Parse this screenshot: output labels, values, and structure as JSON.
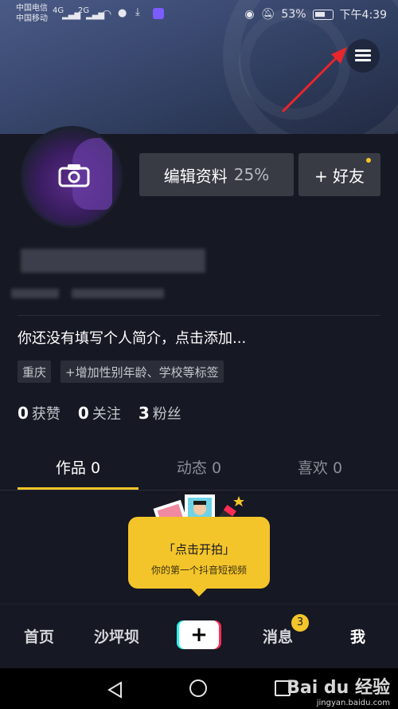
{
  "status_bar": {
    "carrier1": "中国电信",
    "carrier2": "中国移动",
    "signal1": "4G",
    "signal2": "2G",
    "battery": "53%",
    "time": "下午4:39",
    "icons": [
      "eye-icon",
      "mute-icon",
      "battery-icon",
      "wifi-icon",
      "wechat-icon",
      "download-icon",
      "app-icon"
    ]
  },
  "header": {
    "menu_icon": "hamburger-menu-icon",
    "annotation_arrow_color": "#e8262b"
  },
  "profile": {
    "avatar_icon": "camera-icon",
    "edit_label": "编辑资料",
    "edit_progress": "25%",
    "add_friend_label": "+ 好友",
    "bio_placeholder": "你还没有填写个人简介，点击添加...",
    "tags": [
      "重庆",
      "+增加性别年龄、学校等标签"
    ]
  },
  "stats": [
    {
      "value": "0",
      "label": "获赞"
    },
    {
      "value": "0",
      "label": "关注"
    },
    {
      "value": "3",
      "label": "粉丝"
    }
  ],
  "tabs": [
    {
      "label": "作品 0",
      "active": true
    },
    {
      "label": "动态 0",
      "active": false
    },
    {
      "label": "喜欢 0",
      "active": false
    }
  ],
  "prompt": {
    "title": "「点击开拍」",
    "subtitle": "你的第一个抖音短视频"
  },
  "bottom_nav": {
    "items": [
      "首页",
      "沙坪坝",
      "消息",
      "我"
    ],
    "message_badge": "3",
    "plus_label": "+"
  },
  "watermark": {
    "brand": "Bai du 经验",
    "url": "jingyan.baidu.com"
  },
  "colors": {
    "background": "#161823",
    "accent": "#f4c52a",
    "button": "#393b44"
  }
}
